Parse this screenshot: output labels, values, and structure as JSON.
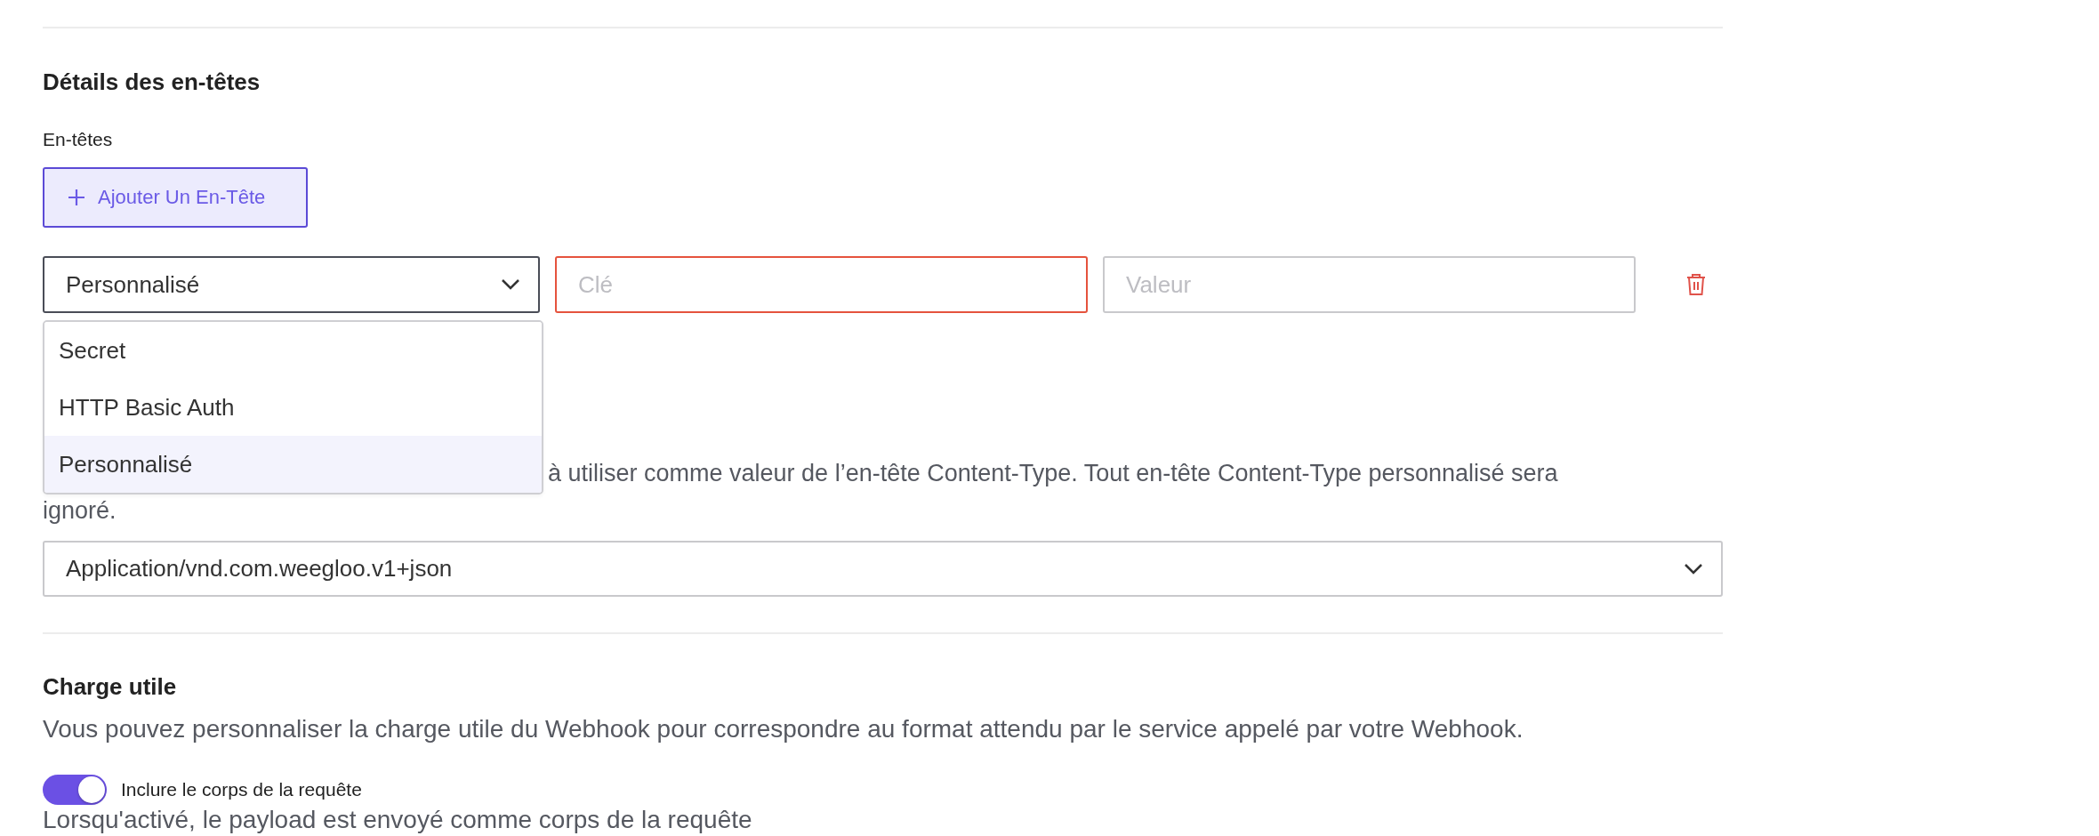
{
  "section_title": "Détails des en-têtes",
  "headers_label": "En-têtes",
  "add_header_button": {
    "label": "Ajouter Un En-Tête"
  },
  "header_row": {
    "type_select": {
      "value": "Personnalisé",
      "expanded": true
    },
    "key_field": {
      "placeholder": "Clé",
      "error": true
    },
    "value_field": {
      "placeholder": "Valeur",
      "error": false
    }
  },
  "type_menu": [
    {
      "label": "Secret",
      "selected": false
    },
    {
      "label": "HTTP Basic Auth",
      "selected": false
    },
    {
      "label": "Personnalisé",
      "selected": true
    }
  ],
  "content_type_help": [
    "à utiliser comme valeur de l’en-tête Content-Type. Tout en-tête Content-Type personnalisé sera",
    "ignoré."
  ],
  "content_type_select": {
    "value": "Application/vnd.com.weegloo.v1+json"
  },
  "payload_section": {
    "title": "Charge utile",
    "description": "Vous pouvez personnaliser la charge utile du Webhook pour correspondre au format attendu par le service appelé par votre Webhook.",
    "include_body_toggle": {
      "label": "Inclure le corps de la requête",
      "on": true
    },
    "note": "Lorsqu'activé, le payload est envoyé comme corps de la requête"
  }
}
